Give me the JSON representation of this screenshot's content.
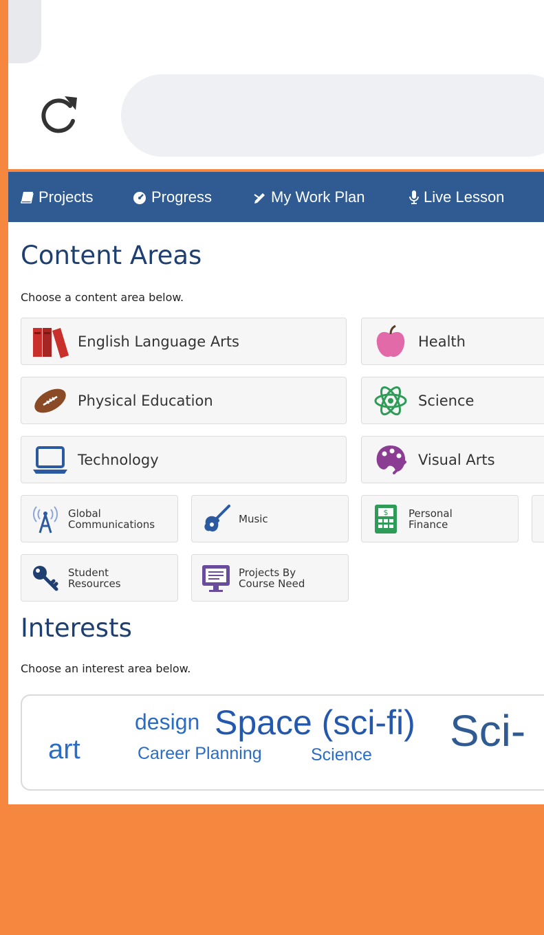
{
  "browser": {
    "reload_icon": "reload-icon",
    "address_value": ""
  },
  "nav": {
    "items": [
      {
        "label": "Projects",
        "icon": "book-icon"
      },
      {
        "label": "Progress",
        "icon": "dashboard-icon"
      },
      {
        "label": "My Work Plan",
        "icon": "pencil-icon"
      },
      {
        "label": "Live Lesson",
        "icon": "microphone-icon"
      }
    ]
  },
  "content_areas": {
    "title": "Content Areas",
    "subtitle": "Choose a content area below.",
    "large_cards": [
      {
        "label": "English Language Arts",
        "icon": "books-icon"
      },
      {
        "label": "Health",
        "icon": "apple-icon"
      },
      {
        "label": "Physical Education",
        "icon": "football-icon"
      },
      {
        "label": "Science",
        "icon": "atom-icon"
      },
      {
        "label": "Technology",
        "icon": "laptop-icon"
      },
      {
        "label": "Visual Arts",
        "icon": "palette-icon"
      }
    ],
    "small_cards": [
      {
        "label": "Global Communications",
        "icon": "antenna-icon"
      },
      {
        "label": "Music",
        "icon": "guitar-icon"
      },
      {
        "label": "Personal Finance",
        "icon": "calculator-icon"
      },
      {
        "label": "Student Resources",
        "icon": "key-icon"
      },
      {
        "label": "Projects By Course Need",
        "icon": "monitor-icon"
      }
    ]
  },
  "interests": {
    "title": "Interests",
    "subtitle": "Choose an interest area below.",
    "tags": [
      {
        "label": "art"
      },
      {
        "label": "design"
      },
      {
        "label": "Space (sci-fi)"
      },
      {
        "label": "Sci-"
      },
      {
        "label": "Career Planning"
      },
      {
        "label": "Science"
      }
    ]
  },
  "colors": {
    "frame": "#f5873e",
    "navbar": "#2f5b92",
    "heading": "#1f3f70",
    "tag": "#2b6cc4"
  }
}
